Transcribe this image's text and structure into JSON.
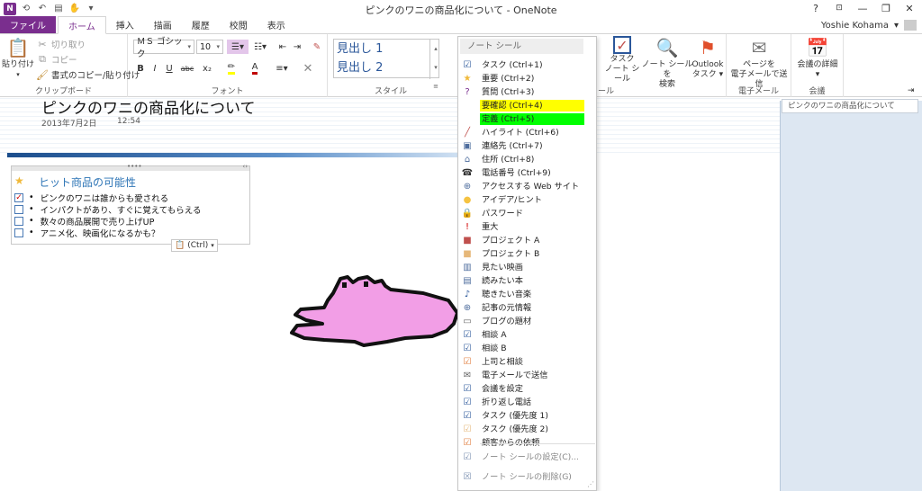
{
  "window": {
    "title": "ピンクのワニの商品化について - OneNote",
    "help": "?",
    "minimize": "—",
    "restore": "❐",
    "close": "✕"
  },
  "qat": {
    "app_icon": "N",
    "back": "⟲",
    "undo": "↶",
    "dock": "▤",
    "touch": "✋",
    "customize": "▾"
  },
  "tabs": [
    "ファイル",
    "ホーム",
    "挿入",
    "描画",
    "履歴",
    "校閲",
    "表示"
  ],
  "user": {
    "name": "Yoshie Kohama",
    "dropdown": "▾"
  },
  "ribbon": {
    "clipboard": {
      "label": "クリップボード",
      "paste": "貼り付け",
      "cut": "切り取り",
      "copy": "コピー",
      "format_painter": "書式のコピー/貼り付け"
    },
    "font": {
      "label": "フォント",
      "font_name": "ＭＳ ゴシック",
      "font_size": "10",
      "bold": "B",
      "italic": "I",
      "underline": "U",
      "strike": "abc",
      "subscript": "x₂"
    },
    "styles": {
      "label": "スタイル",
      "heading1": "見出し 1",
      "heading2": "見出し 2"
    },
    "tags_group_label_fragment": "ール",
    "task": {
      "line1": "タスク",
      "line2": "ノート シール"
    },
    "find_tags": {
      "line1": "ノート シールを",
      "line2": "検索"
    },
    "outlook": {
      "line1": "Outlook",
      "line2": "タスク ▾"
    },
    "email": {
      "label": "電子メール",
      "line1": "ページを",
      "line2": "電子メールで送信"
    },
    "meeting": {
      "label": "会議",
      "line1": "会議の詳細",
      "line2": "▾"
    }
  },
  "page": {
    "title": "ピンクのワニの商品化について",
    "date": "2013年7月2日",
    "time": "12:54",
    "note": {
      "heading": "ヒット商品の可能性",
      "items": [
        {
          "text": "ピンクのワニは誰からも愛される",
          "checked": true
        },
        {
          "text": "インパクトがあり、すぐに覚えてもらえる",
          "checked": false
        },
        {
          "text": "数々の商品展開で売り上げUP",
          "checked": false
        },
        {
          "text": "アニメ化、映画化になるかも？",
          "checked": false
        }
      ],
      "paste_options": "(Ctrl)"
    }
  },
  "right_pane": {
    "page_tab": "ピンクのワニの商品化について"
  },
  "menu": {
    "header": "ノート シール",
    "items": [
      {
        "label": "タスク (Ctrl+1)",
        "icon": "checkbox-icon",
        "glyph": "☑",
        "color": "#2b579a"
      },
      {
        "label": "重要 (Ctrl+2)",
        "icon": "star-icon",
        "glyph": "★",
        "color": "#f0b93a"
      },
      {
        "label": "質問 (Ctrl+3)",
        "icon": "question-icon",
        "glyph": "?",
        "color": "#7a2e8e"
      },
      {
        "label": "要確認 (Ctrl+4)",
        "icon": "none",
        "glyph": "",
        "color": "#333",
        "highlight": "#ffff00"
      },
      {
        "label": "定義 (Ctrl+5)",
        "icon": "none",
        "glyph": "",
        "color": "#333",
        "highlight": "#00ff00"
      },
      {
        "label": "ハイライト (Ctrl+6)",
        "icon": "highlighter-icon",
        "glyph": "╱",
        "color": "#c0504d"
      },
      {
        "label": "連絡先 (Ctrl+7)",
        "icon": "contact-card-icon",
        "glyph": "▣",
        "color": "#4f6e9e"
      },
      {
        "label": "住所 (Ctrl+8)",
        "icon": "house-icon",
        "glyph": "⌂",
        "color": "#4f6e9e"
      },
      {
        "label": "電話番号 (Ctrl+9)",
        "icon": "phone-icon",
        "glyph": "☎",
        "color": "#333"
      },
      {
        "label": "アクセスする Web サイト",
        "icon": "globe-icon",
        "glyph": "⊕",
        "color": "#4f6e9e"
      },
      {
        "label": "アイデア/ヒント",
        "icon": "lightbulb-icon",
        "glyph": "●",
        "color": "#f5c342"
      },
      {
        "label": "パスワード",
        "icon": "lock-icon",
        "glyph": "🔒",
        "color": "#d6a32a"
      },
      {
        "label": "重大",
        "icon": "exclamation-icon",
        "glyph": "!",
        "color": "#d00000"
      },
      {
        "label": "プロジェクト A",
        "icon": "square-red-icon",
        "glyph": "■",
        "color": "#c0504d"
      },
      {
        "label": "プロジェクト B",
        "icon": "square-tan-icon",
        "glyph": "■",
        "color": "#e6b87a"
      },
      {
        "label": "見たい映画",
        "icon": "film-icon",
        "glyph": "▥",
        "color": "#4f6e9e"
      },
      {
        "label": "読みたい本",
        "icon": "book-icon",
        "glyph": "▤",
        "color": "#4f6e9e"
      },
      {
        "label": "聴きたい音楽",
        "icon": "music-note-icon",
        "glyph": "♪",
        "color": "#2b579a"
      },
      {
        "label": "記事の元情報",
        "icon": "globe-icon",
        "glyph": "⊕",
        "color": "#4f6e9e"
      },
      {
        "label": "ブログの題材",
        "icon": "speech-bubble-icon",
        "glyph": "▭",
        "color": "#666"
      },
      {
        "label": "相談 A",
        "icon": "checkbox-person-icon",
        "glyph": "☑",
        "color": "#2b579a"
      },
      {
        "label": "相談 B",
        "icon": "checkbox-person-icon",
        "glyph": "☑",
        "color": "#2b579a"
      },
      {
        "label": "上司と相談",
        "icon": "checkbox-person-icon",
        "glyph": "☑",
        "color": "#e07b39"
      },
      {
        "label": "電子メールで送信",
        "icon": "envelope-icon",
        "glyph": "✉",
        "color": "#666"
      },
      {
        "label": "会議を設定",
        "icon": "checkbox-calendar-icon",
        "glyph": "☑",
        "color": "#2b579a"
      },
      {
        "label": "折り返し電話",
        "icon": "checkbox-phone-icon",
        "glyph": "☑",
        "color": "#2b579a"
      },
      {
        "label": "タスク (優先度 1)",
        "icon": "priority1-icon",
        "glyph": "☑",
        "color": "#2b579a"
      },
      {
        "label": "タスク (優先度 2)",
        "icon": "priority2-icon",
        "glyph": "☑",
        "color": "#e6b87a"
      },
      {
        "label": "顧客からの依頼",
        "icon": "checkbox-client-icon",
        "glyph": "☑",
        "color": "#e07b39"
      }
    ],
    "footer": [
      {
        "label": "ノート シールの設定(C)...",
        "icon": "tag-settings-icon",
        "glyph": "☑"
      },
      {
        "label": "ノート シールの削除(G)",
        "icon": "tag-remove-icon",
        "glyph": "☒"
      }
    ],
    "grip": "⋰"
  }
}
